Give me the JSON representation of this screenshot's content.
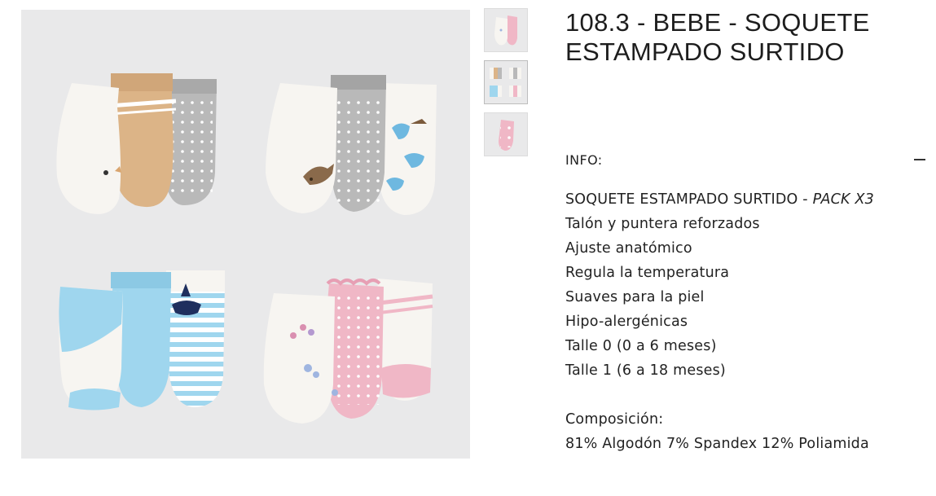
{
  "product": {
    "title": "108.3 - BEBE - SOQUETE ESTAMPADO SURTIDO"
  },
  "gallery": {
    "thumbnails": [
      {
        "name": "thumbnail-white-pink-socks",
        "active": false
      },
      {
        "name": "thumbnail-four-packs",
        "active": true
      },
      {
        "name": "thumbnail-pink-sock",
        "active": false
      }
    ]
  },
  "info": {
    "label": "INFO:",
    "toggle_icon": "minus-icon",
    "description_main": "SOQUETE ESTAMPADO SURTIDO - ",
    "description_pack": "PACK X3",
    "features": [
      "Talón y puntera reforzados",
      "Ajuste anatómico",
      "Regula la temperatura",
      "Suaves para la piel",
      "Hipo-alergénicas",
      "Talle 0 (0 a 6 meses)",
      "Talle 1 (6 a 18 meses)"
    ],
    "composition_label": "Composición:",
    "composition_value": "81% Algodón 7% Spandex 12% Poliamida"
  },
  "colors": {
    "background": "#e9e9ea",
    "sock_white": "#f7f5f1",
    "sock_tan": "#dcb487",
    "sock_gray": "#b9b9b9",
    "sock_blue": "#9fd6ee",
    "sock_pink": "#f0b7c6"
  }
}
